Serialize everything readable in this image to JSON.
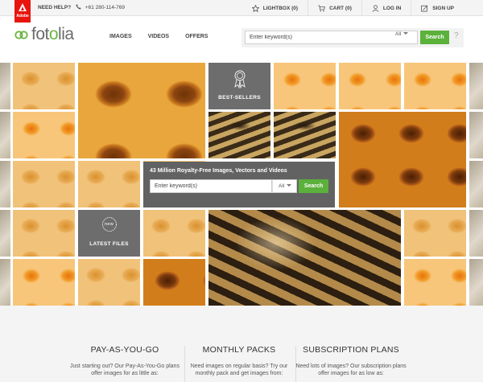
{
  "topbar": {
    "adobe_label": "Adobe",
    "need_help": "NEED HELP?",
    "phone": "+61 280-114-769",
    "lightbox": "LIGHTBOX (0)",
    "cart": "CART (0)",
    "login": "LOG IN",
    "signup": "SIGN UP"
  },
  "header": {
    "logo_prefix": "fot",
    "logo_accent": "o",
    "logo_suffix": "lia",
    "nav": [
      "IMAGES",
      "VIDEOS",
      "OFFERS"
    ],
    "search_placeholder": "Enter keyword(s)",
    "search_filter": "All",
    "search_button": "Search",
    "help_mark": "?"
  },
  "hero": {
    "bestsellers_label": "BEST-SELLERS",
    "latest_label": "LATEST FILES",
    "new_badge": "new",
    "panel_title": "43 Million Royalty-Free Images, Vectors and Videos",
    "panel_placeholder": "Enter keyword(s)",
    "panel_filter": "All",
    "panel_button": "Search"
  },
  "plans": [
    {
      "title": "PAY-AS-YOU-GO",
      "text": "Just starting out? Our Pay-As-You-Go plans offer images for as little as:"
    },
    {
      "title": "MONTHLY PACKS",
      "text": "Need images on regular basis? Try our monthly pack and get images from:"
    },
    {
      "title": "SUBSCRIPTION PLANS",
      "text": "Need lots of images? Our subscription plans offer images for as low as:"
    }
  ],
  "colors": {
    "accent": "#5bb13b",
    "adobe_red": "#e8150f",
    "panel_gray": "#626262"
  }
}
